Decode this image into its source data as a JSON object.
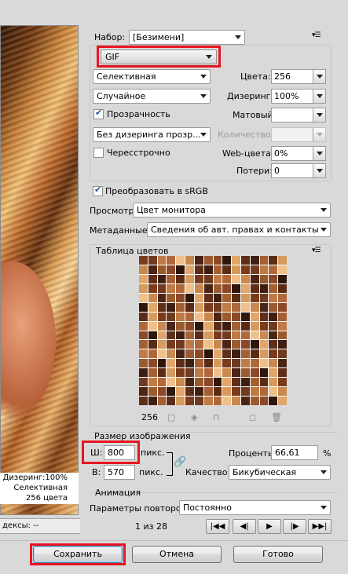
{
  "preview": {
    "info_lines": [
      "Дизеринг:100%",
      "Селективная",
      "256 цвета"
    ],
    "status_text": "дексы: --"
  },
  "preset": {
    "label": "Набор:",
    "value": "[Безимени]"
  },
  "format": {
    "value": "GIF"
  },
  "settings": {
    "reduction": "Селективная",
    "dither_algo": "Случайное",
    "transparency_label": "Прозрачность",
    "transparency_checked": true,
    "transparency_dither": "Без дизеринга прозр...",
    "interlaced_label": "Чересстрочно",
    "interlaced_checked": false,
    "colors_label": "Цвета:",
    "colors_value": "256",
    "dither_label": "Дизеринг:",
    "dither_value": "100%",
    "matte_label": "Матовый:",
    "matte_value": "",
    "amount_label": "Количество:",
    "amount_value": "",
    "websnap_label": "Web-цвета:",
    "websnap_value": "0%",
    "lossy_label": "Потери:",
    "lossy_value": "0"
  },
  "convert_srgb": {
    "label": "Преобразовать в sRGB",
    "checked": true
  },
  "view": {
    "label": "Просмотр:",
    "value": "Цвет монитора"
  },
  "metadata": {
    "label": "Метаданные:",
    "value": "Сведения об авт. правах и контакты"
  },
  "color_table": {
    "title": "Таблица цветов",
    "count": "256",
    "colors": [
      "#7a3a1c",
      "#9b5a2e",
      "#5a2c16",
      "#c8884e",
      "#3e1e10",
      "#b0683a",
      "#e2a66a",
      "#6e3a20",
      "#8c4828",
      "#d69a5c",
      "#4a2414",
      "#a46032",
      "#f0c08a",
      "#5e2e18",
      "#c07a46",
      "#2e160a"
    ]
  },
  "image_size": {
    "title": "Размер изображения",
    "width_label": "Ш:",
    "width_value": "800",
    "height_label": "В:",
    "height_value": "570",
    "unit": "пикс.",
    "percent_label": "Проценты:",
    "percent_value": "66,61",
    "percent_unit": "%",
    "quality_label": "Качество:",
    "quality_value": "Бикубическая"
  },
  "animation": {
    "title": "Анимация",
    "loop_label": "Параметры повторов:",
    "loop_value": "Постоянно",
    "frame_counter": "1 из 28"
  },
  "buttons": {
    "save": "Сохранить",
    "cancel": "Отмена",
    "done": "Готово"
  },
  "highlight_color": "#e8141f"
}
